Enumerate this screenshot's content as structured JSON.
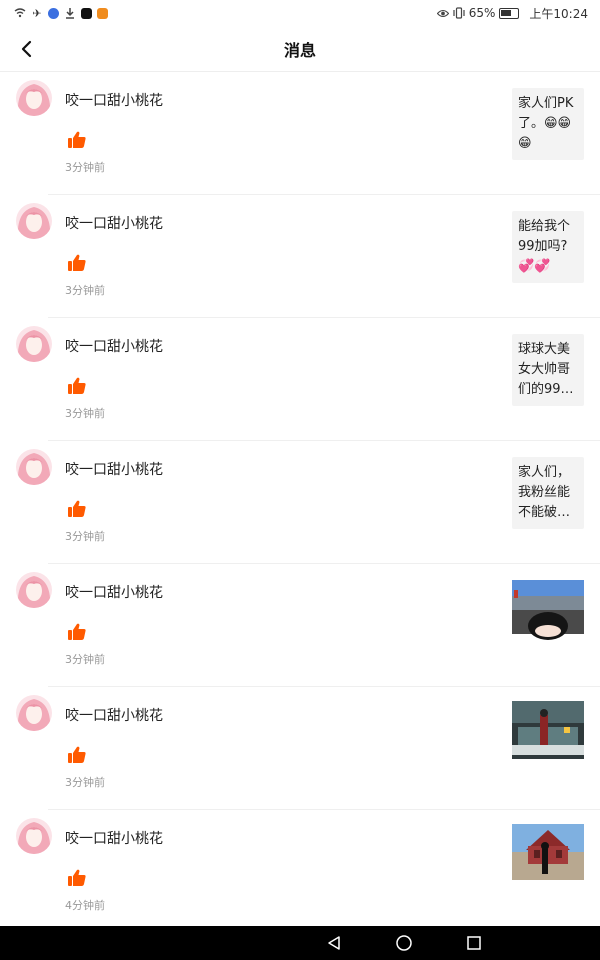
{
  "status_bar": {
    "battery": "65%",
    "time": "上午10:24"
  },
  "header": {
    "title": "消息"
  },
  "messages": [
    {
      "sender": "咬一口甜小桃花",
      "time": "3分钟前",
      "preview": "家人们PK了。😁😁😁"
    },
    {
      "sender": "咬一口甜小桃花",
      "time": "3分钟前",
      "preview": "能给我个99加吗?💞💞"
    },
    {
      "sender": "咬一口甜小桃花",
      "time": "3分钟前",
      "preview": "球球大美女大帅哥们的99…"
    },
    {
      "sender": "咬一口甜小桃花",
      "time": "3分钟前",
      "preview": "家人们，我粉丝能不能破…"
    },
    {
      "sender": "咬一口甜小桃花",
      "time": "3分钟前",
      "preview_image": "road-scene-thumbnail"
    },
    {
      "sender": "咬一口甜小桃花",
      "time": "3分钟前",
      "preview_image": "stage-character-thumbnail"
    },
    {
      "sender": "咬一口甜小桃花",
      "time": "4分钟前",
      "preview_image": "building-character-thumbnail"
    }
  ],
  "colors": {
    "like": "#ff5a00",
    "avatar_hair": "#f2a9b8",
    "nav_bar": "#000000"
  }
}
